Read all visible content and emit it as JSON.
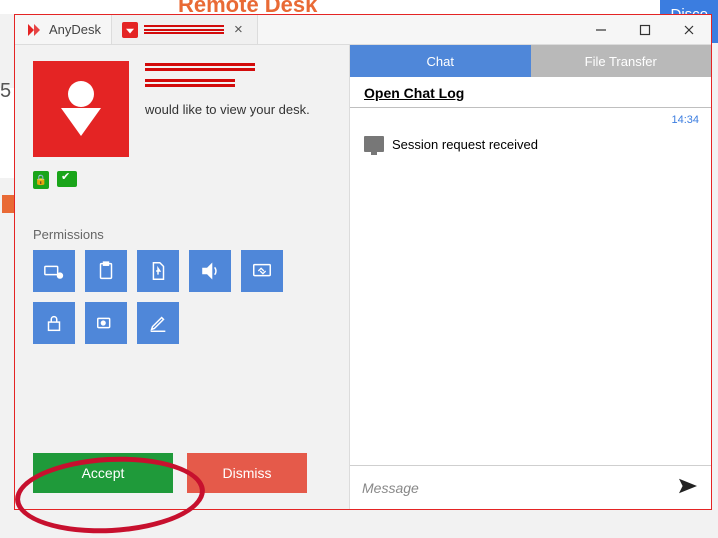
{
  "background": {
    "remote_text": "Remote Desk",
    "disco_text": "Disco",
    "left_num": "5"
  },
  "titlebar": {
    "app_tab": "AnyDesk",
    "session_tab_redacted": true
  },
  "requester": {
    "name_redacted": true,
    "id_redacted": true,
    "message": "would like to view your desk."
  },
  "permissions": {
    "label": "Permissions",
    "items": [
      {
        "key": "keyboard-mouse-icon"
      },
      {
        "key": "clipboard-icon"
      },
      {
        "key": "file-icon"
      },
      {
        "key": "audio-icon"
      },
      {
        "key": "screen-icon"
      },
      {
        "key": "lock-icon"
      },
      {
        "key": "record-icon"
      },
      {
        "key": "draw-icon"
      }
    ]
  },
  "actions": {
    "accept": "Accept",
    "dismiss": "Dismiss"
  },
  "right": {
    "tabs": {
      "chat": "Chat",
      "file_transfer": "File Transfer"
    },
    "open_log": "Open Chat Log",
    "timestamp": "14:34",
    "event": "Session request received",
    "message_placeholder": "Message"
  }
}
